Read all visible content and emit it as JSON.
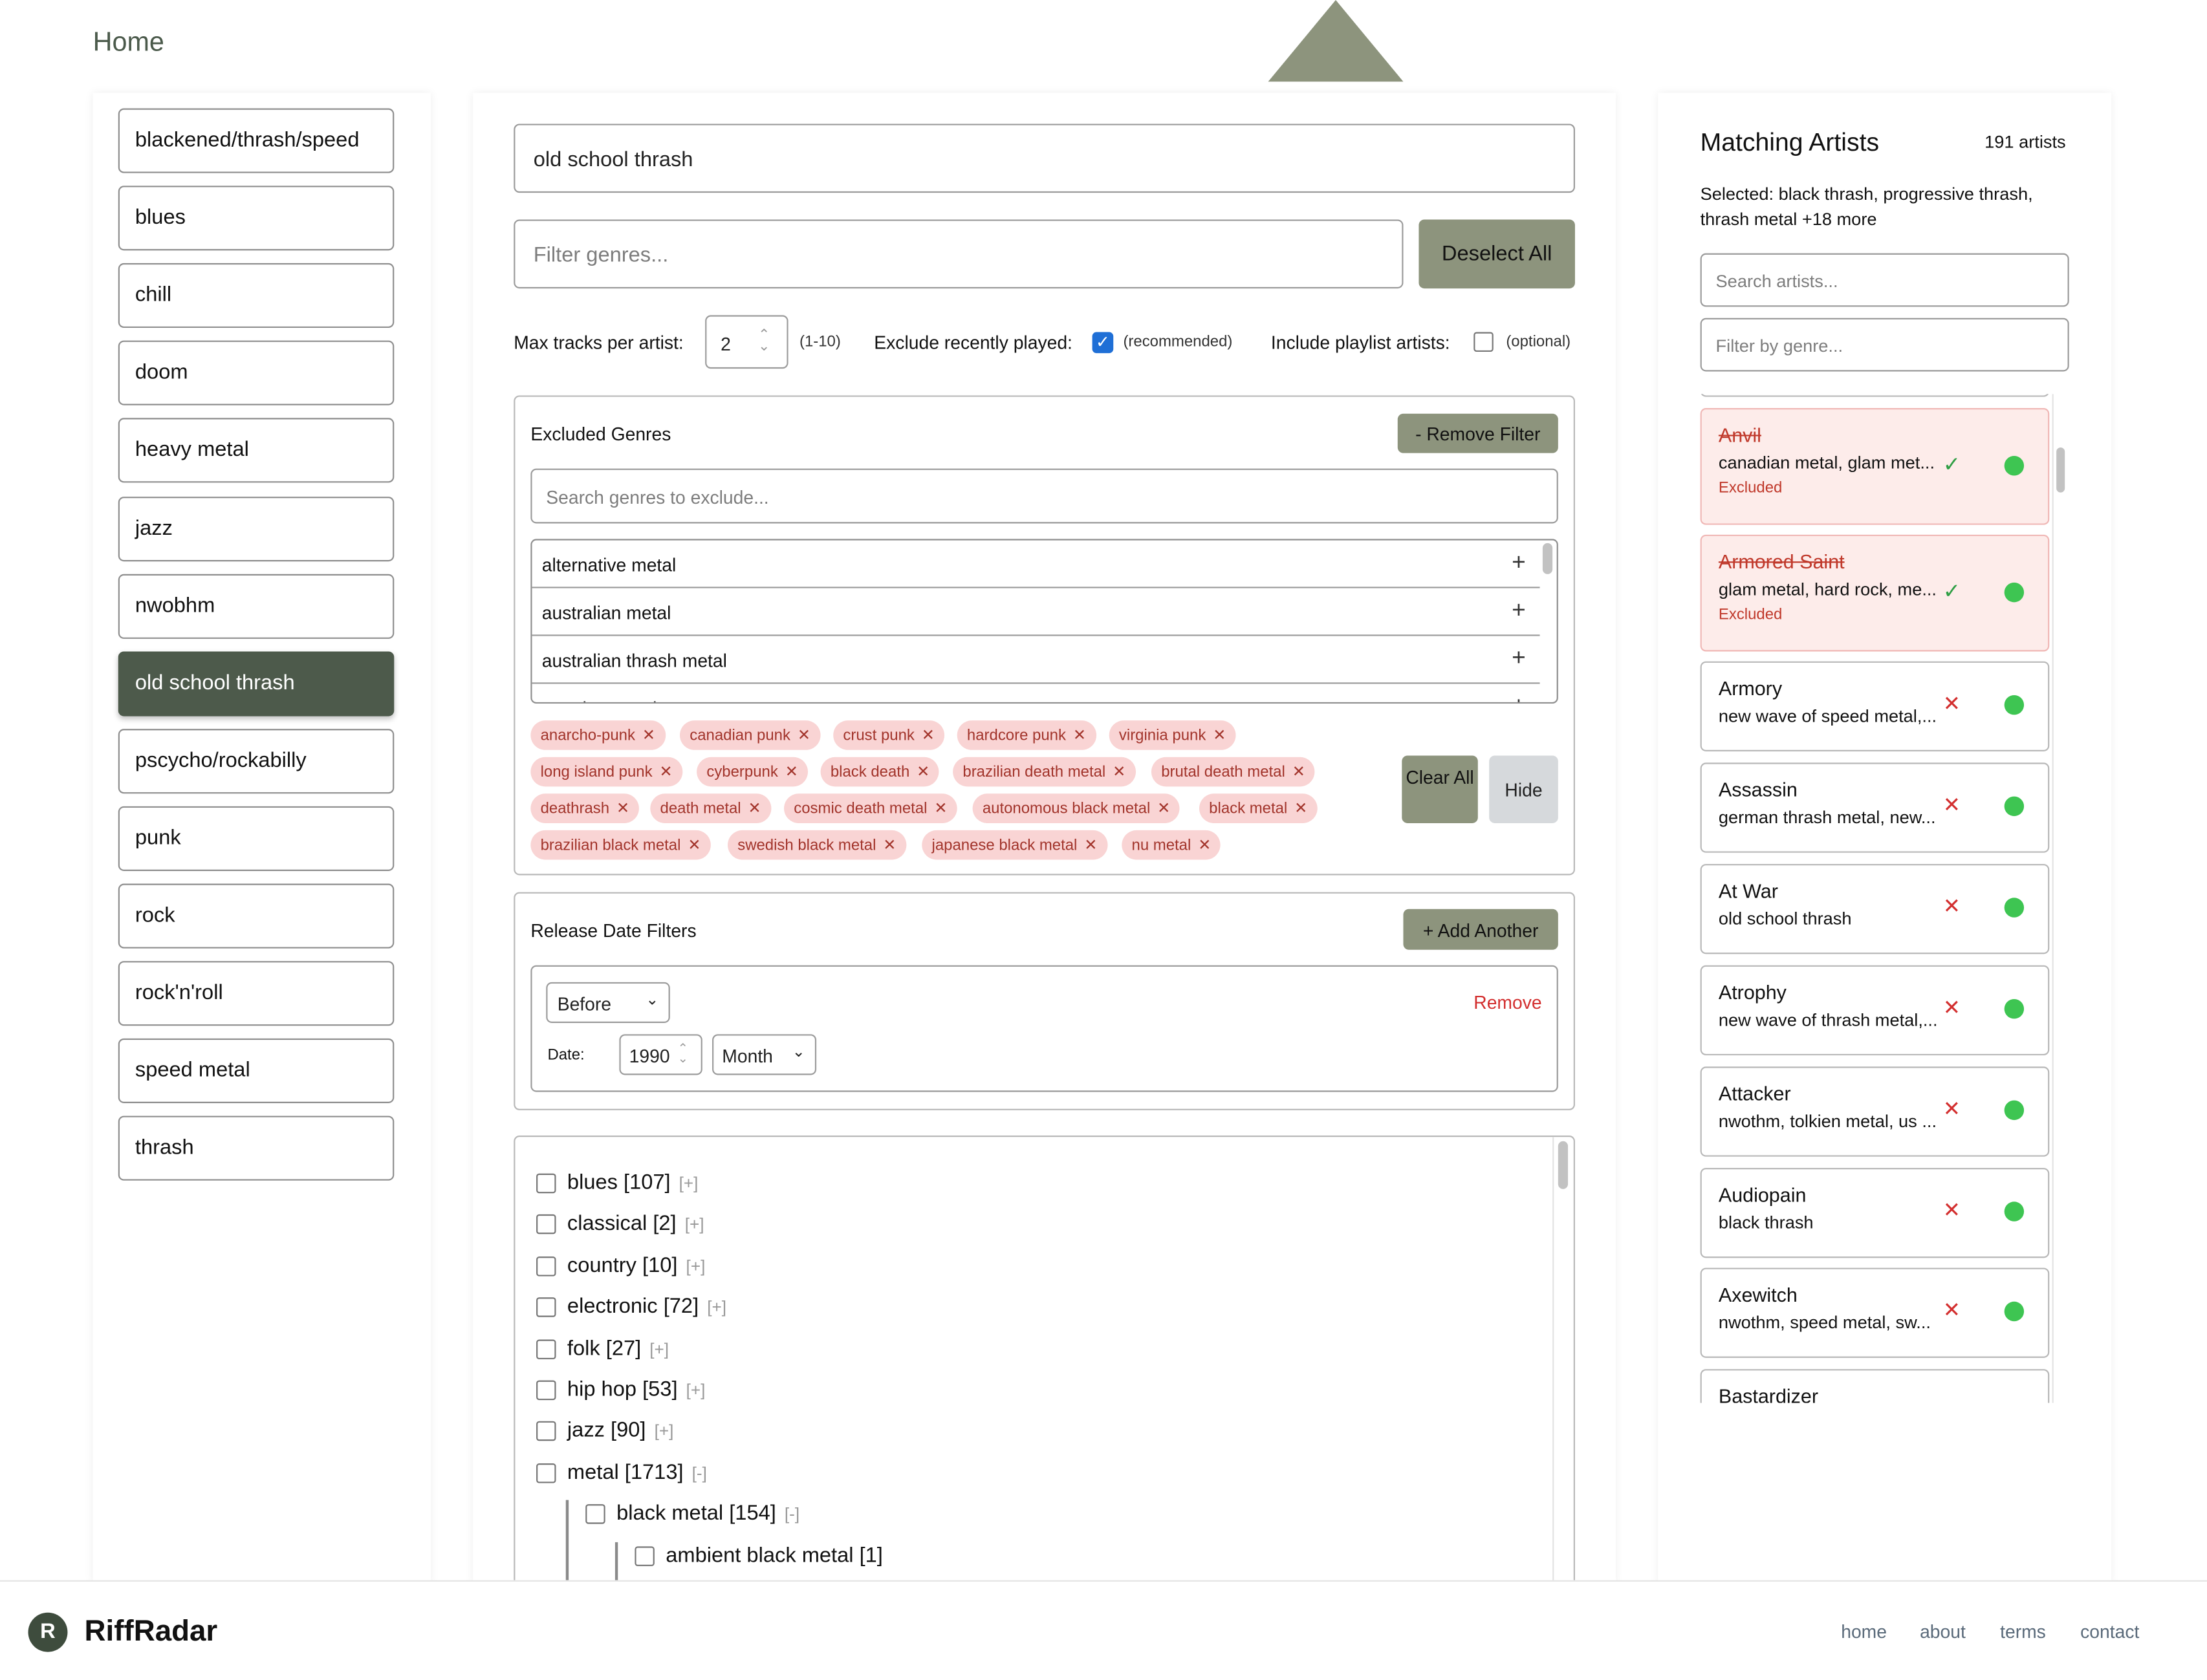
{
  "nav": {
    "home": "Home"
  },
  "genres": [
    "blackened/thrash/speed",
    "blues",
    "chill",
    "doom",
    "heavy metal",
    "jazz",
    "nwobhm",
    "old school thrash",
    "pscycho/rockabilly",
    "punk",
    "rock",
    "rock'n'roll",
    "speed metal",
    "thrash"
  ],
  "selected_genre": "old school thrash",
  "center": {
    "playlist_name": "old school thrash",
    "filter_placeholder": "Filter genres...",
    "deselect_all": "Deselect All",
    "max_tracks_label": "Max tracks per artist:",
    "max_tracks_value": "2",
    "max_tracks_range": "(1-10)",
    "exclude_recent_label": "Exclude recently played:",
    "exclude_recent_note": "(recommended)",
    "exclude_recent_checked": true,
    "include_playlist_label": "Include playlist artists:",
    "include_playlist_note": "(optional)",
    "include_playlist_checked": false
  },
  "excluded": {
    "title": "Excluded Genres",
    "remove_filter": "- Remove Filter",
    "search_placeholder": "Search genres to exclude...",
    "options": [
      "alternative metal",
      "australian metal",
      "australian thrash metal",
      "austrian metal"
    ],
    "tags": [
      "anarcho-punk",
      "canadian punk",
      "crust punk",
      "hardcore punk",
      "virginia punk",
      "long island punk",
      "cyberpunk",
      "black death",
      "brazilian death metal",
      "brutal death metal",
      "deathrash",
      "death metal",
      "cosmic death metal",
      "autonomous black metal",
      "black metal",
      "brazilian black metal",
      "swedish black metal",
      "japanese black metal",
      "nu metal"
    ],
    "clear_all": "Clear All",
    "hide": "Hide"
  },
  "release": {
    "title": "Release Date Filters",
    "add_another": "+ Add Another",
    "when": "Before",
    "remove": "Remove",
    "date_label": "Date:",
    "year": "1990",
    "month": "Month"
  },
  "tree": [
    {
      "label": "blues [107]",
      "toggle": "[+]"
    },
    {
      "label": "classical [2]",
      "toggle": "[+]"
    },
    {
      "label": "country [10]",
      "toggle": "[+]"
    },
    {
      "label": "electronic [72]",
      "toggle": "[+]"
    },
    {
      "label": "folk [27]",
      "toggle": "[+]"
    },
    {
      "label": "hip hop [53]",
      "toggle": "[+]"
    },
    {
      "label": "jazz [90]",
      "toggle": "[+]"
    },
    {
      "label": "metal [1713]",
      "toggle": "[-]"
    },
    {
      "label": "black metal [154]",
      "toggle": "[-]"
    },
    {
      "label": "ambient black metal [1]",
      "toggle": ""
    }
  ],
  "artists_panel": {
    "title": "Matching Artists",
    "count": "191 artists",
    "selected_text": "Selected: black thrash, progressive thrash, thrash metal +18 more",
    "search_placeholder": "Search artists...",
    "genre_placeholder": "Filter by genre..."
  },
  "artists": [
    {
      "name": "Anvil",
      "genres": "canadian metal, glam met...",
      "excluded": true,
      "status": "Excluded"
    },
    {
      "name": "Armored Saint",
      "genres": "glam metal, hard rock, me...",
      "excluded": true,
      "status": "Excluded"
    },
    {
      "name": "Armory",
      "genres": "new wave of speed metal,...",
      "excluded": false,
      "status": ""
    },
    {
      "name": "Assassin",
      "genres": "german thrash metal, new...",
      "excluded": false,
      "status": ""
    },
    {
      "name": "At War",
      "genres": "old school thrash",
      "excluded": false,
      "status": ""
    },
    {
      "name": "Atrophy",
      "genres": "new wave of thrash metal,...",
      "excluded": false,
      "status": ""
    },
    {
      "name": "Attacker",
      "genres": "nwothm, tolkien metal, us ...",
      "excluded": false,
      "status": ""
    },
    {
      "name": "Audiopain",
      "genres": "black thrash",
      "excluded": false,
      "status": ""
    },
    {
      "name": "Axewitch",
      "genres": "nwothm, speed metal, sw...",
      "excluded": false,
      "status": ""
    },
    {
      "name": "Bastardizer",
      "genres": "",
      "excluded": false,
      "status": ""
    }
  ],
  "footer": {
    "brand": "RiffRadar",
    "links": [
      "home",
      "about",
      "terms",
      "contact"
    ]
  },
  "colors": {
    "accent": "#8d947d",
    "selected": "#4d5a4b",
    "excluded_bg": "#fdecea",
    "tag_bg": "#f9d4d4",
    "spotify": "#3ec552",
    "danger": "#d32f2f"
  }
}
